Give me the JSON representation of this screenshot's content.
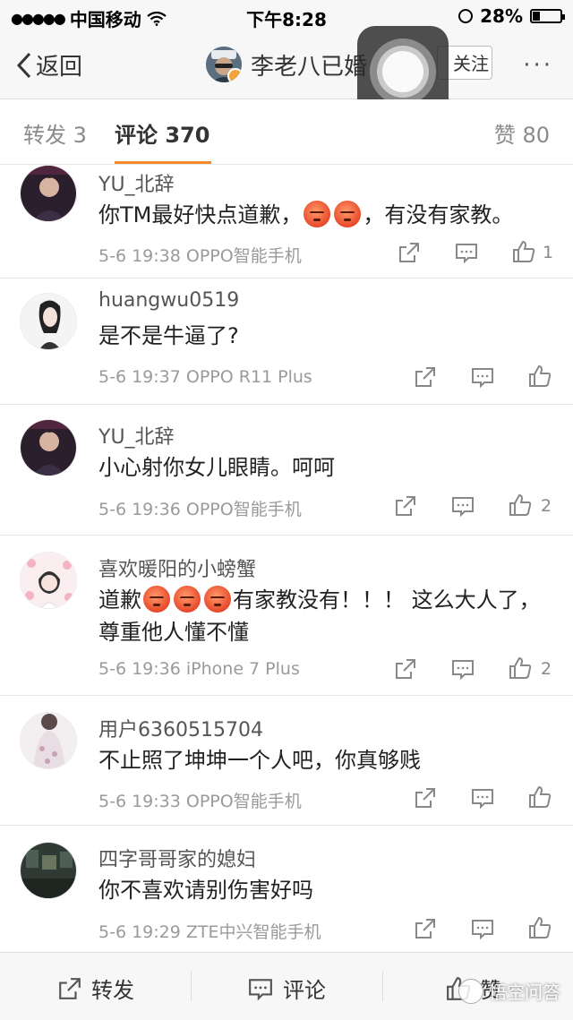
{
  "status": {
    "carrier": "中国移动",
    "time": "下午8:28",
    "battery": "28%",
    "battery_level": 0.28
  },
  "nav": {
    "back_label": "返回",
    "title": "李老八已婚",
    "follow_label": "关注",
    "more_label": "···"
  },
  "tabs": {
    "repost": "转发 3",
    "comments": "评论 370",
    "likes": "赞 80"
  },
  "comments": [
    {
      "name": "YU_北辞",
      "text_before": "你TM最好快点道歉，",
      "emoji_count": 2,
      "text_after": "，有没有家教。",
      "time": "5-6 19:38",
      "device": "OPPO智能手机",
      "likes": "1"
    },
    {
      "name": "huangwu0519",
      "text": "是不是牛逼了?",
      "time": "5-6 19:37",
      "device": "OPPO R11 Plus",
      "likes": ""
    },
    {
      "name": "YU_北辞",
      "text": "小心射你女儿眼睛。呵呵",
      "time": "5-6 19:36",
      "device": "OPPO智能手机",
      "likes": "2"
    },
    {
      "name": "喜欢暖阳的小螃蟹",
      "text_before": "道歉",
      "emoji_count": 3,
      "text_after": "有家教没有！！！ 这么大人了，尊重他人懂不懂",
      "time": "5-6 19:36",
      "device": "iPhone 7 Plus",
      "likes": "2"
    },
    {
      "name": "用户6360515704",
      "text": "不止照了坤坤一个人吧，你真够贱",
      "time": "5-6 19:33",
      "device": "OPPO智能手机",
      "likes": ""
    },
    {
      "name": "四字哥哥家的媳妇",
      "text": "你不喜欢请别伤害好吗",
      "time": "5-6 19:29",
      "device": "ZTE中兴智能手机",
      "likes": ""
    }
  ],
  "bottom": {
    "repost": "转发",
    "comment": "评论",
    "like": "赞"
  },
  "watermark": "悟空问答",
  "colors": {
    "accent": "#f38a2a",
    "text": "#222222",
    "meta": "#9a9a9a"
  },
  "icons": [
    "back-chevron-icon",
    "share-icon",
    "comment-icon",
    "thumbs-up-icon",
    "angry-emoji-icon"
  ]
}
